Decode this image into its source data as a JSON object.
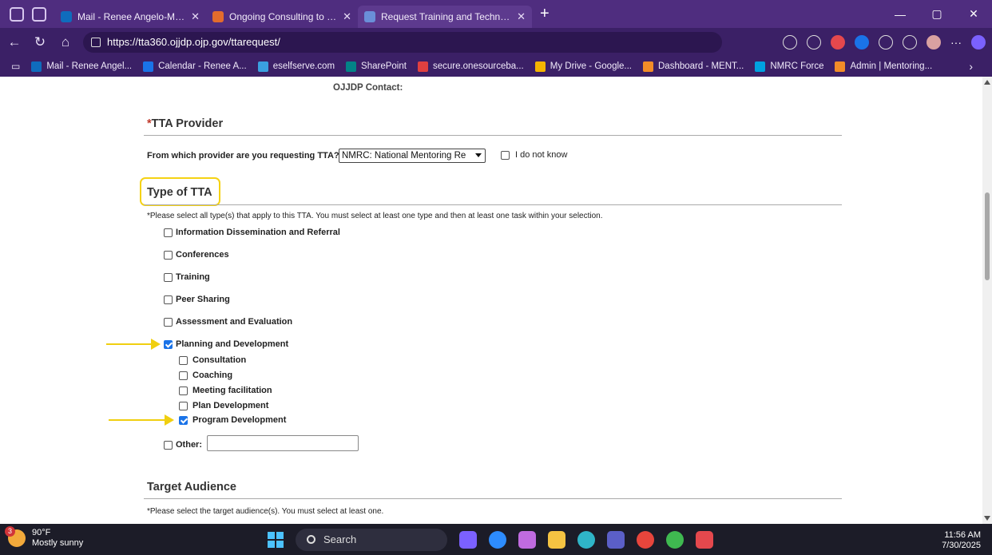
{
  "browser": {
    "tabs": [
      {
        "label": "Mail - Renee Angelo-Mauk - Outl",
        "color": "#0f6cbd",
        "active": false
      },
      {
        "label": "Ongoing Consulting to Support M",
        "color": "#e36c2d",
        "active": false
      },
      {
        "label": "Request Training and Technical As",
        "color": "#6a8fd8",
        "active": true
      }
    ],
    "new_tab": "+",
    "window_controls": [
      "—",
      "▢",
      "✕"
    ],
    "url": "https://tta360.ojjdp.ojp.gov/ttarequest/",
    "bookmarks": [
      {
        "label": "Mail - Renee Angel...",
        "color": "#0f6cbd"
      },
      {
        "label": "Calendar - Renee A...",
        "color": "#1a73e8"
      },
      {
        "label": "eselfserve.com",
        "color": "#3aa0e0"
      },
      {
        "label": "SharePoint",
        "color": "#038387"
      },
      {
        "label": "secure.onesourceba...",
        "color": "#e04040"
      },
      {
        "label": "My Drive - Google...",
        "color": "#f4b400"
      },
      {
        "label": "Dashboard - MENT...",
        "color": "#f28c28"
      },
      {
        "label": "NMRC Force",
        "color": "#00a1e0"
      },
      {
        "label": "Admin | Mentoring...",
        "color": "#f28c28"
      }
    ]
  },
  "form": {
    "ojjdp_contact": "OJJDP Contact:",
    "tta_provider": {
      "required_mark": "*",
      "title": "TTA Provider",
      "question": "From which provider are you requesting TTA?",
      "selected": "NMRC: National Mentoring Re",
      "dont_know": "I do not know"
    },
    "type_of_tta": {
      "title": "Type of TTA",
      "instructions": "*Please select all type(s) that apply to this TTA. You must select at least one type and then at least one task within your selection.",
      "types": [
        {
          "label": "Information Dissemination and Referral",
          "checked": false
        },
        {
          "label": "Conferences",
          "checked": false
        },
        {
          "label": "Training",
          "checked": false
        },
        {
          "label": "Peer Sharing",
          "checked": false
        },
        {
          "label": "Assessment and Evaluation",
          "checked": false
        },
        {
          "label": "Planning and Development",
          "checked": true
        }
      ],
      "tasks": [
        {
          "label": "Consultation",
          "checked": false
        },
        {
          "label": "Coaching",
          "checked": false
        },
        {
          "label": "Meeting facilitation",
          "checked": false
        },
        {
          "label": "Plan Development",
          "checked": false
        },
        {
          "label": "Program Development",
          "checked": true
        }
      ],
      "other_label": "Other:",
      "other_value": ""
    },
    "target_audience": {
      "title": "Target Audience",
      "instructions": "*Please select the target audience(s). You must select at least one."
    }
  },
  "annotation_color": "#f5d214",
  "taskbar": {
    "weather_badge": "3",
    "temperature": "90°F",
    "condition": "Mostly sunny",
    "search_placeholder": "Search",
    "time": "11:56 AM",
    "date": "7/30/2025",
    "apps": [
      {
        "name": "copilot-icon",
        "color": "#7b61ff"
      },
      {
        "name": "zoom-icon",
        "color": "#2d8cff"
      },
      {
        "name": "snipping-icon",
        "color": "#c06be0"
      },
      {
        "name": "file-explorer-icon",
        "color": "#f5c342"
      },
      {
        "name": "edge-icon",
        "color": "#2fb5c8"
      },
      {
        "name": "teams-icon",
        "color": "#5b5fc7"
      },
      {
        "name": "chrome-icon",
        "color": "#e8453c"
      },
      {
        "name": "app-green-icon",
        "color": "#3fb950"
      },
      {
        "name": "app-red-icon",
        "color": "#e5484d"
      }
    ]
  }
}
